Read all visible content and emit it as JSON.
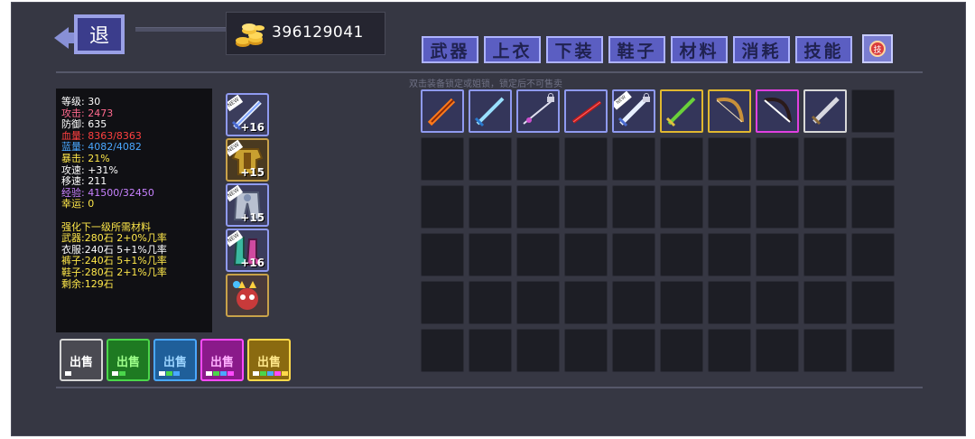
{
  "back_button": {
    "label": "退"
  },
  "gold": {
    "amount": "396129041",
    "icon": "gold-coins-icon"
  },
  "tabs": [
    {
      "label": "武器",
      "active": true
    },
    {
      "label": "上衣"
    },
    {
      "label": "下装"
    },
    {
      "label": "鞋子"
    },
    {
      "label": "材料"
    },
    {
      "label": "消耗"
    },
    {
      "label": "技能"
    }
  ],
  "skill_tab_icon": {
    "icon": "skill-orb-icon"
  },
  "hint": "双击装备锁定或姐锁，锁定后不可售卖",
  "stats": [
    {
      "text": "等级: 30",
      "color": "#ffffff"
    },
    {
      "text": "攻击: 2473",
      "color": "#ff6a8e"
    },
    {
      "text": "防御: 635",
      "color": "#ffffff"
    },
    {
      "text": "血量: 8363/8363",
      "color": "#ff4040"
    },
    {
      "text": "蓝量: 4082/4082",
      "color": "#4aa8ff"
    },
    {
      "text": "暴击: 21%",
      "color": "#ffe84a"
    },
    {
      "text": "攻速: +31%",
      "color": "#ffffff"
    },
    {
      "text": "移速: 211",
      "color": "#ffffff"
    },
    {
      "text": "经验: 41500/32450",
      "color": "#c882ff"
    },
    {
      "text": "幸运: 0",
      "color": "#ffe84a"
    },
    {
      "text": "",
      "color": "#ffffff"
    },
    {
      "text": "强化下一级所需材料",
      "color": "#ffe84a"
    },
    {
      "text": "武器:280石 2+0%几率",
      "color": "#ffe84a"
    },
    {
      "text": "衣服:240石 5+1%几率",
      "color": "#ffffff"
    },
    {
      "text": "裤子:240石 5+1%几率",
      "color": "#ffe84a"
    },
    {
      "text": "鞋子:280石 2+1%几率",
      "color": "#ffe84a"
    },
    {
      "text": "剩余:129石",
      "color": "#ffe84a"
    }
  ],
  "equipped": [
    {
      "slot": "weapon",
      "icon": "sword-icon",
      "level": "+16",
      "border": "#8f9af0"
    },
    {
      "slot": "armor",
      "icon": "gold-armor-icon",
      "level": "+15",
      "border": "#c8a24a"
    },
    {
      "slot": "pants",
      "icon": "steel-pants-icon",
      "level": "+15",
      "border": "#8f9af0"
    },
    {
      "slot": "boots",
      "icon": "boots-icon",
      "level": "+16",
      "border": "#8f9af0"
    },
    {
      "slot": "pet",
      "icon": "pet-creature-icon",
      "level": "",
      "border": "#c8a24a"
    }
  ],
  "sell_buttons": [
    {
      "label": "出售",
      "bg": "#4a4a52",
      "border": "#d6d6d6",
      "text": "#ffffff",
      "dots": [
        "#ffffff"
      ]
    },
    {
      "label": "出售",
      "bg": "#1e7a22",
      "border": "#4ad64a",
      "text": "#9dff8a",
      "dots": [
        "#ffffff",
        "#4ad64a"
      ]
    },
    {
      "label": "出售",
      "bg": "#1f5f9a",
      "border": "#4aa8ff",
      "text": "#9bd4ff",
      "dots": [
        "#ffffff",
        "#4ad64a",
        "#4aa8ff"
      ]
    },
    {
      "label": "出售",
      "bg": "#8a1a8a",
      "border": "#ff4aff",
      "text": "#ffb0ff",
      "dots": [
        "#ffffff",
        "#4ad64a",
        "#4aa8ff",
        "#ff4aff"
      ]
    },
    {
      "label": "出售",
      "bg": "#8a6a10",
      "border": "#ffd84a",
      "text": "#ffe88a",
      "dots": [
        "#ffffff",
        "#4ad64a",
        "#4aa8ff",
        "#ff4aff",
        "#ffd84a"
      ]
    }
  ],
  "inventory_row1": [
    {
      "icon": "flame-sword-icon",
      "border": "#8f9af0",
      "locked": false,
      "new": false
    },
    {
      "icon": "ice-sword-icon",
      "border": "#8f9af0",
      "locked": false,
      "new": false
    },
    {
      "icon": "rapier-icon",
      "border": "#8f9af0",
      "locked": true,
      "new": false
    },
    {
      "icon": "blood-sword-icon",
      "border": "#8f9af0",
      "locked": false,
      "new": false
    },
    {
      "icon": "sword-icon",
      "border": "#8f9af0",
      "locked": true,
      "new": true
    },
    {
      "icon": "green-sword-icon",
      "border": "#e0b830",
      "locked": false,
      "new": false
    },
    {
      "icon": "bow-icon",
      "border": "#e0b830",
      "locked": false,
      "new": false
    },
    {
      "icon": "dark-bow-icon",
      "border": "#e040e0",
      "locked": false,
      "new": false
    },
    {
      "icon": "silver-sword-icon",
      "border": "#d8d8d8",
      "locked": false,
      "new": false
    },
    {
      "icon": "",
      "border": "",
      "locked": false,
      "new": false
    }
  ]
}
